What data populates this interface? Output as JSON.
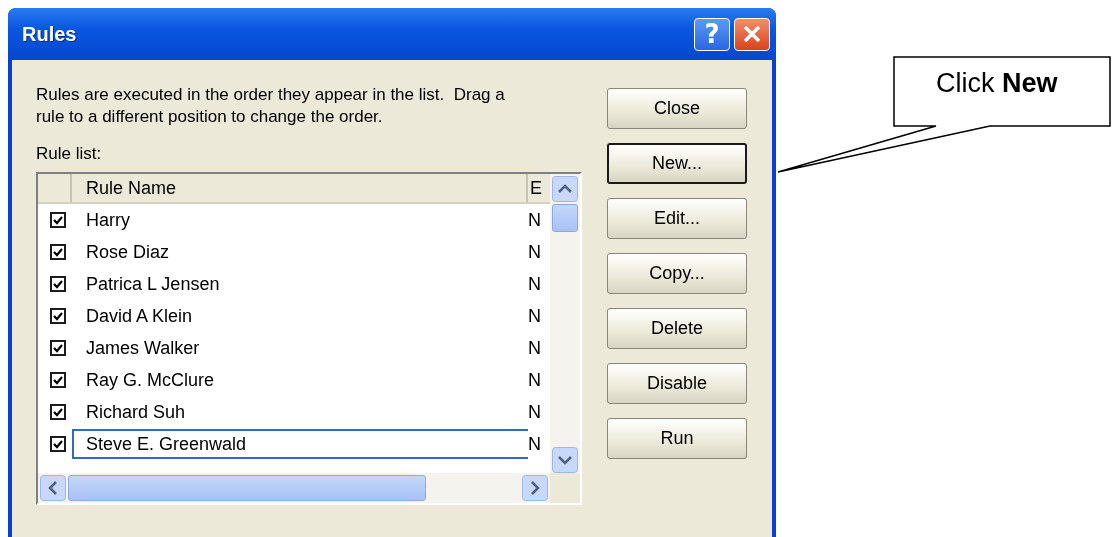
{
  "window": {
    "title": "Rules",
    "help_label": "?"
  },
  "description": "Rules are executed in the order they appear in the list.  Drag a rule to a different position to change the order.",
  "list_label": "Rule list:",
  "table": {
    "columns": [
      "Rule Name",
      "E"
    ],
    "rows": [
      {
        "checked": true,
        "name": "Harry",
        "column_2": "N",
        "selected": false
      },
      {
        "checked": true,
        "name": "Rose Diaz",
        "column_2": "N",
        "selected": false
      },
      {
        "checked": true,
        "name": "Patrica L Jensen",
        "column_2": "N",
        "selected": false
      },
      {
        "checked": true,
        "name": "David A Klein",
        "column_2": "N",
        "selected": false
      },
      {
        "checked": true,
        "name": "James Walker",
        "column_2": "N",
        "selected": false
      },
      {
        "checked": true,
        "name": "Ray G. McClure",
        "column_2": "N",
        "selected": false
      },
      {
        "checked": true,
        "name": "Richard Suh",
        "column_2": "N",
        "selected": false
      },
      {
        "checked": true,
        "name": "Steve E. Greenwald",
        "column_2": "N",
        "selected": true
      }
    ]
  },
  "buttons": [
    {
      "label": "Close",
      "focused": false
    },
    {
      "label": "New...",
      "focused": true
    },
    {
      "label": "Edit...",
      "focused": false
    },
    {
      "label": "Copy...",
      "focused": false
    },
    {
      "label": "Delete",
      "focused": false
    },
    {
      "label": "Disable",
      "focused": false
    },
    {
      "label": "Run",
      "focused": false
    }
  ],
  "callout": {
    "text": "Click **New**"
  }
}
